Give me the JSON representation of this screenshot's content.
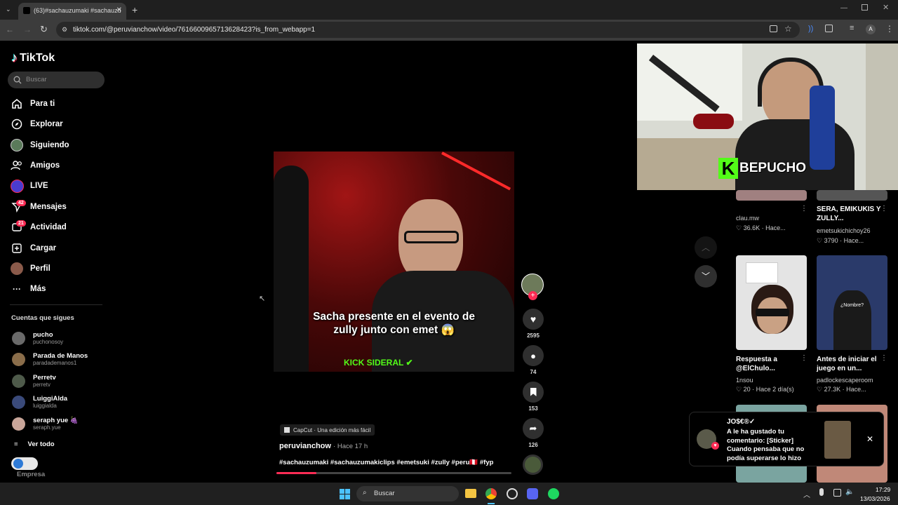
{
  "browser": {
    "tab_title": "(63)#sachauzumaki #sachauzu",
    "url": "tiktok.com/@peruvianchow/video/7616600965713628423?is_from_webapp=1",
    "new_tab_icon": "plus-icon"
  },
  "sidebar": {
    "logo": "TikTok",
    "search_placeholder": "Buscar",
    "nav": [
      {
        "label": "Para ti",
        "icon": "home-icon"
      },
      {
        "label": "Explorar",
        "icon": "compass-icon"
      },
      {
        "label": "Siguiendo",
        "icon": "following-avatar-icon"
      },
      {
        "label": "Amigos",
        "icon": "friends-icon"
      },
      {
        "label": "LIVE",
        "icon": "live-icon"
      },
      {
        "label": "Mensajes",
        "icon": "messages-icon",
        "badge": "42"
      },
      {
        "label": "Actividad",
        "icon": "activity-icon",
        "badge": "21"
      },
      {
        "label": "Cargar",
        "icon": "upload-icon"
      },
      {
        "label": "Perfil",
        "icon": "profile-avatar-icon"
      },
      {
        "label": "Más",
        "icon": "more-icon"
      }
    ],
    "following_heading": "Cuentas que sigues",
    "following": [
      {
        "name": "pucho",
        "handle": "puchonosoy",
        "color": "#6a6a6a"
      },
      {
        "name": "Parada de Manos",
        "handle": "paradademanos1",
        "color": "#8a6d4a"
      },
      {
        "name": "Perretv",
        "handle": "perretv",
        "color": "#4e5a4a"
      },
      {
        "name": "LuiggiAlda",
        "handle": "luiggialda",
        "color": "#3a4a7a"
      },
      {
        "name": "seraph yue 🍇",
        "handle": "seraph.yue",
        "color": "#c9a69a"
      }
    ],
    "see_all": "Ver todo",
    "business": "Empresa"
  },
  "video": {
    "caption_line1": "Sacha presente en el evento de",
    "caption_line2": "zully junto con emet 😱",
    "watermark": "KICK SIDERAL",
    "capcut": "CapCut · Una edición más fácil",
    "author": "peruvianchow",
    "time": "· Hace 17 h",
    "hashtags": "#sachauzumaki #sachauzumakiclips #emetsuki #zully #peru🇵🇪 #fyp",
    "progress": 0.17
  },
  "actions": {
    "likes": "2595",
    "comments": "74",
    "saves": "153",
    "shares": "126"
  },
  "webcam": {
    "overlay_name": "BEPUCHO"
  },
  "recommendations": [
    {
      "author": "clau.mw",
      "meta": "♡ 36.6K · Hace..."
    },
    {
      "title": "SERA, EMIKUKIS Y ZULLY...",
      "author": "emetsukichichoy26",
      "meta": "♡ 3790 · Hace..."
    },
    {
      "title": "Respuesta a @ElChulo...",
      "author": "1nsou",
      "meta": "♡ 20 · Hace 2 día(s)"
    },
    {
      "title": "Antes de iniciar el juego en un...",
      "author": "padlockescaperoom",
      "meta": "♡ 27.3K · Hace..."
    }
  ],
  "thumb_text": "¿Nombre?",
  "notification": {
    "user": "JO$€®✓",
    "text": "A le ha gustado tu comentario: [Sticker] Cuando pensaba que no podía superarse lo hizo"
  },
  "taskbar": {
    "search": "Buscar",
    "time": "17:29",
    "date": "13/03/2026"
  },
  "colors": {
    "accent": "#fe2c55",
    "kick_green": "#53fc18"
  }
}
